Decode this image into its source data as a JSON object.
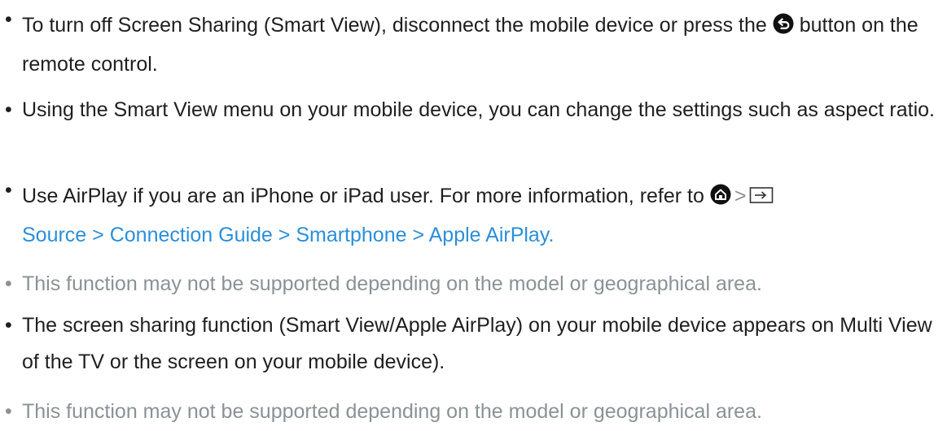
{
  "colors": {
    "text": "#1f1f1f",
    "muted": "#8a9296",
    "link": "#2b8fd8"
  },
  "bullet": "•",
  "items": [
    {
      "text": "To turn off Screen Sharing (Smart View), disconnect the mobile device or press the",
      "icon": "return-icon",
      "text_after": "button on the remote control."
    },
    {
      "text": "Using the Smart View menu on your mobile device, you can change the settings such as aspect ratio."
    },
    {
      "text": "Use AirPlay if you are an iPhone or iPad user. For more information, refer to",
      "icons": [
        "home-icon",
        "source-icon"
      ],
      "separator": ">",
      "link": "Source > Connection Guide > Smartphone > Apple AirPlay."
    },
    {
      "text": "This function may not be supported depending on the model or geographical area."
    },
    {
      "text": "The screen sharing function (Smart View/Apple AirPlay) on your mobile device appears on Multi View of the TV or the screen on your mobile device)."
    },
    {
      "text": "This function may not be supported depending on the model or geographical area."
    }
  ]
}
